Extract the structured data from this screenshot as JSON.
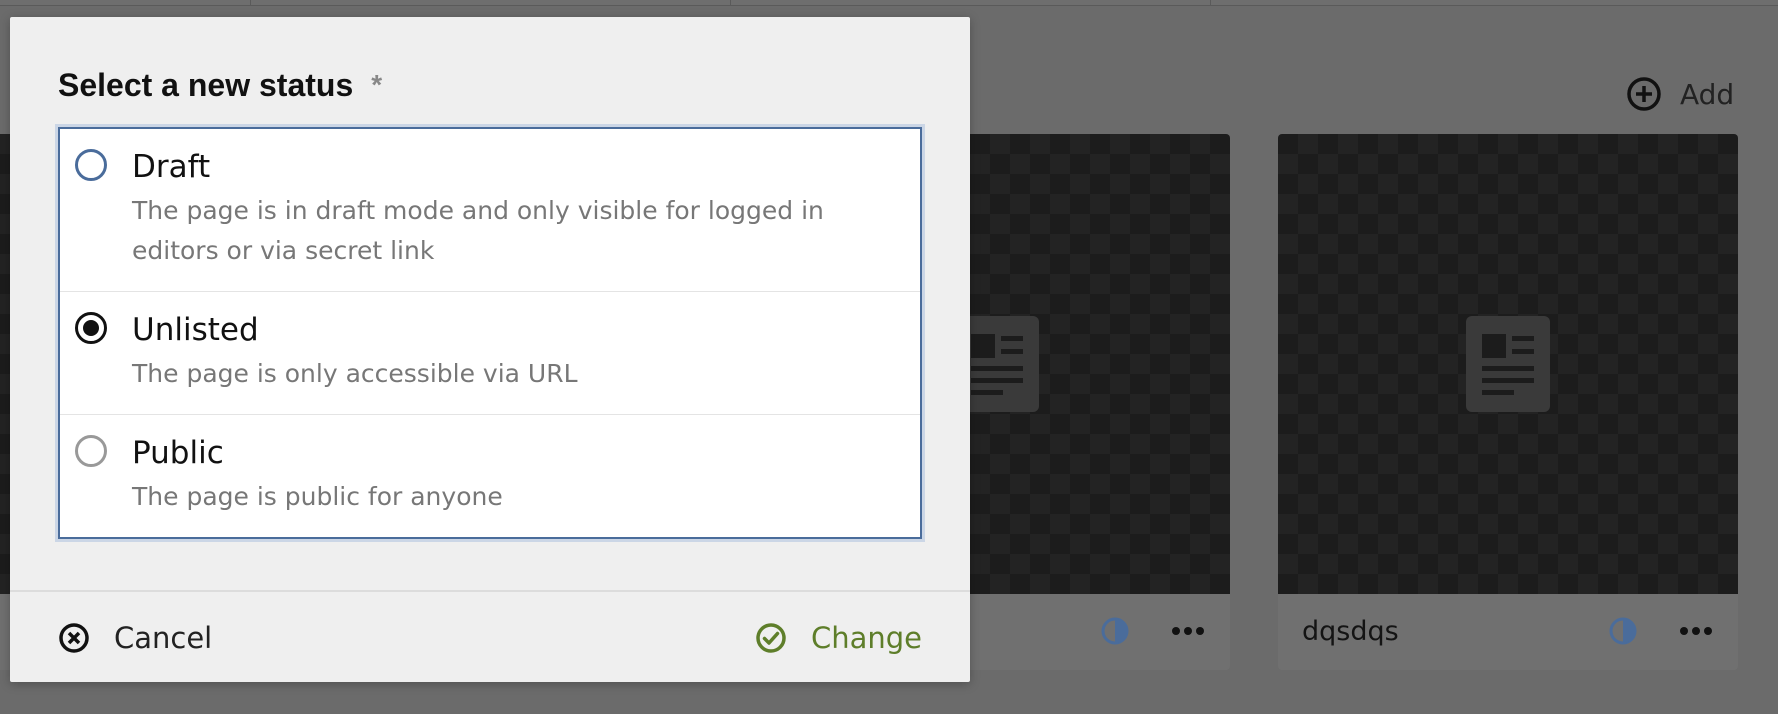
{
  "background": {
    "add_label": "Add",
    "cards": [
      {
        "title": ""
      },
      {
        "title": "dqsdqs"
      }
    ]
  },
  "dialog": {
    "label": "Select a new status",
    "required_marker": "*",
    "selected": "unlisted",
    "options": [
      {
        "value": "draft",
        "label": "Draft",
        "info": "The page is in draft mode and only visible for logged in editors or via secret link"
      },
      {
        "value": "unlisted",
        "label": "Unlisted",
        "info": "The page is only accessible via URL"
      },
      {
        "value": "public",
        "label": "Public",
        "info": "The page is public for anyone"
      }
    ],
    "cancel_label": "Cancel",
    "submit_label": "Change"
  },
  "colors": {
    "overlay": "#6b6b6b",
    "dialog_bg": "#efefef",
    "focus": "#4a6c9b",
    "positive": "#5e7e2a"
  }
}
